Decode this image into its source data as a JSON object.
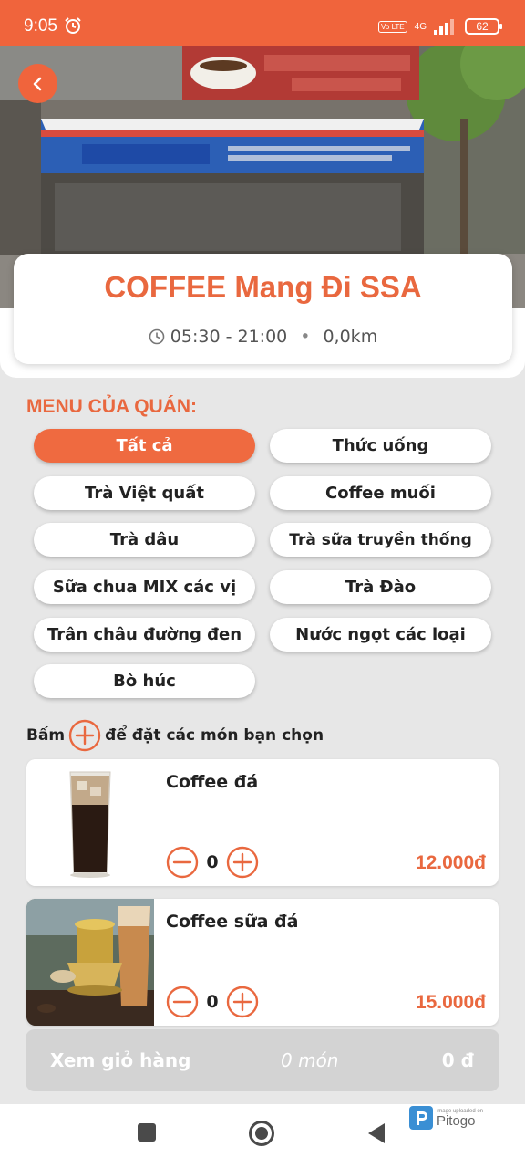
{
  "status_bar": {
    "time": "9:05",
    "network": "4G",
    "volte": "Vo LTE",
    "battery": "62"
  },
  "store": {
    "name": "COFFEE Mang Đi SSA",
    "hours": "05:30 - 21:00",
    "distance": "0,0km"
  },
  "menu": {
    "title": "MENU CỦA QUÁN:",
    "categories": [
      {
        "label": "Tất cả",
        "active": true
      },
      {
        "label": "Thức uống",
        "active": false
      },
      {
        "label": "Trà Việt quất",
        "active": false
      },
      {
        "label": "Coffee muối",
        "active": false
      },
      {
        "label": "Trà dâu",
        "active": false
      },
      {
        "label": "Trà sữa truyền thống",
        "active": false
      },
      {
        "label": "Sữa chua MIX các vị",
        "active": false
      },
      {
        "label": "Trà Đào",
        "active": false
      },
      {
        "label": "Trân châu đường đen",
        "active": false
      },
      {
        "label": "Nước ngọt các loại",
        "active": false
      },
      {
        "label": "Bò húc",
        "active": false
      }
    ]
  },
  "instruction": {
    "before": "Bấm",
    "after": "để đặt các món bạn chọn"
  },
  "products": [
    {
      "name": "Coffee đá",
      "quantity": "0",
      "price": "12.000đ"
    },
    {
      "name": "Coffee sữa đá",
      "quantity": "0",
      "price": "15.000đ"
    }
  ],
  "cart": {
    "label": "Xem giỏ hàng",
    "count": "0 món",
    "total": "0 đ"
  },
  "watermark": {
    "small_text": "image uploaded on",
    "brand": "Pitogo"
  },
  "colors": {
    "accent": "#f0643c",
    "price": "#e9683f",
    "cart_disabled": "#d3d3d3"
  },
  "icons": {
    "back": "chevron-left-icon",
    "clock": "clock-icon",
    "plus": "plus-circle-icon",
    "minus": "minus-circle-icon",
    "nav_recents": "square-icon",
    "nav_home": "circle-icon",
    "nav_back": "triangle-back-icon"
  }
}
